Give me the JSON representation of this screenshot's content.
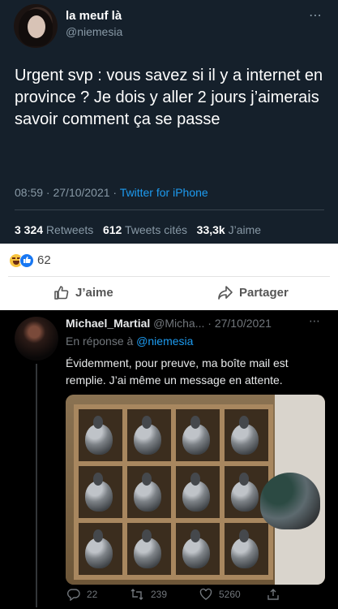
{
  "tweet": {
    "display_name": "la meuf là",
    "handle": "@niemesia",
    "more_icon": "⋯",
    "text": "Urgent svp : vous savez si il y a internet en province ? Je dois y aller 2 jours j’aimerais savoir comment ça se passe",
    "time": "08:59 · 27/10/2021 · ",
    "source": "Twitter for iPhone",
    "retweets_count": "3 324",
    "retweets_label": " Retweets",
    "quotes_count": "612",
    "quotes_label": " Tweets cités",
    "likes_count": "33,3k",
    "likes_label": " J’aime"
  },
  "facebook": {
    "reaction_count": "62",
    "like_label": "J’aime",
    "share_label": "Partager"
  },
  "reply": {
    "display_name": "Michael_Martial",
    "handle_date": " @Micha... · 27/10/2021",
    "more_icon": "⋯",
    "reply_prefix": "En réponse à ",
    "reply_handle": "@niemesia",
    "text": "Évidemment, pour preuve, ma boîte mail est remplie. J’ai même un message en attente.",
    "reply_count": "22",
    "retweet_count": "239",
    "like_count": "5260"
  },
  "colors": {
    "tweet_bg": "#15202b",
    "reply_bg": "#000000",
    "link_blue": "#1d9bf0",
    "fb_blue": "#1877f2"
  }
}
